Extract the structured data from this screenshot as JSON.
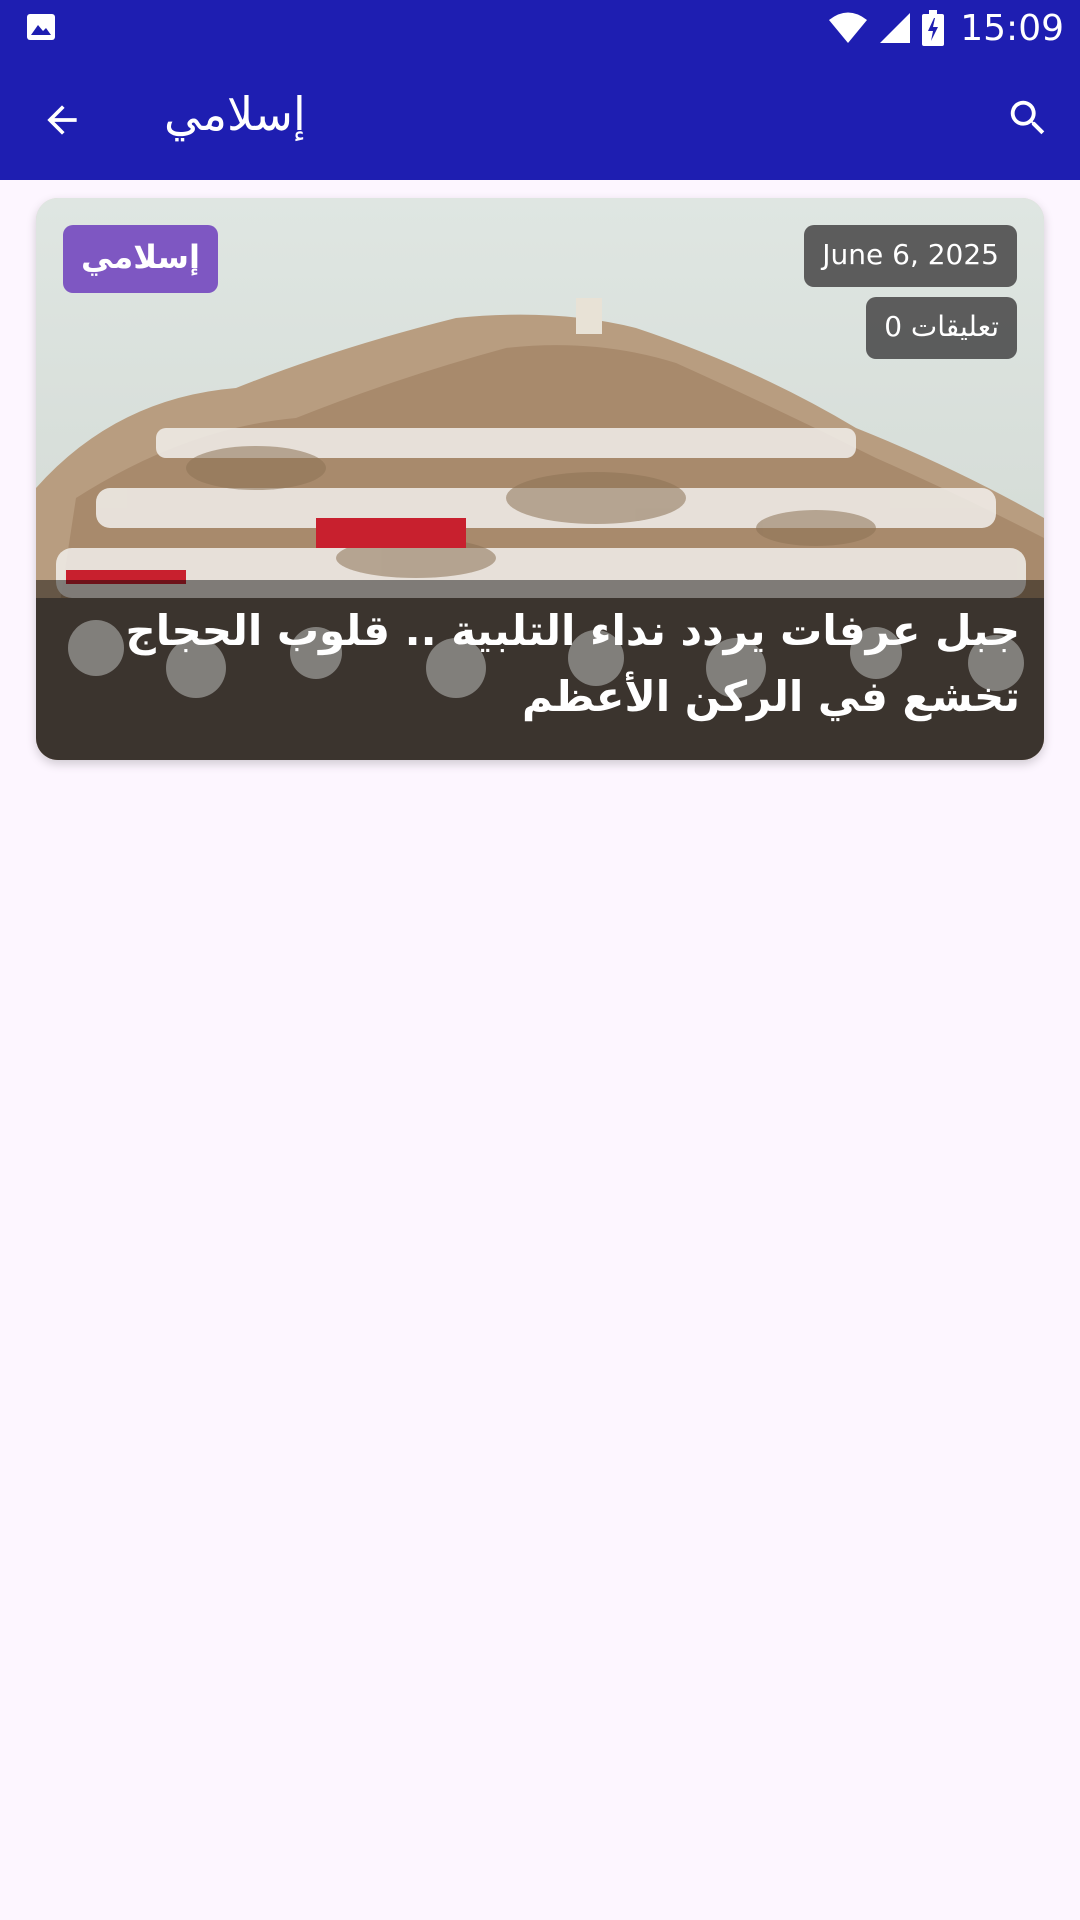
{
  "status_bar": {
    "time": "15:09",
    "icons": [
      "image-icon",
      "wifi-icon",
      "signal-icon",
      "battery-charging-icon"
    ]
  },
  "app_bar": {
    "title": "إسلامي",
    "icons": [
      "back-arrow-icon",
      "search-icon"
    ]
  },
  "article_card": {
    "category": "إسلامي",
    "date": "June 6, 2025",
    "comments": "تعليقات 0",
    "title": "جبل عرفات يردد نداء التلبية .. قلوب الحجاج تخشع في الركن الأعظم"
  },
  "colors": {
    "app_bar": "#1e1eb1",
    "background": "#fdf6ff",
    "category_badge": "#7e57c2",
    "meta_badge": "#505050"
  }
}
